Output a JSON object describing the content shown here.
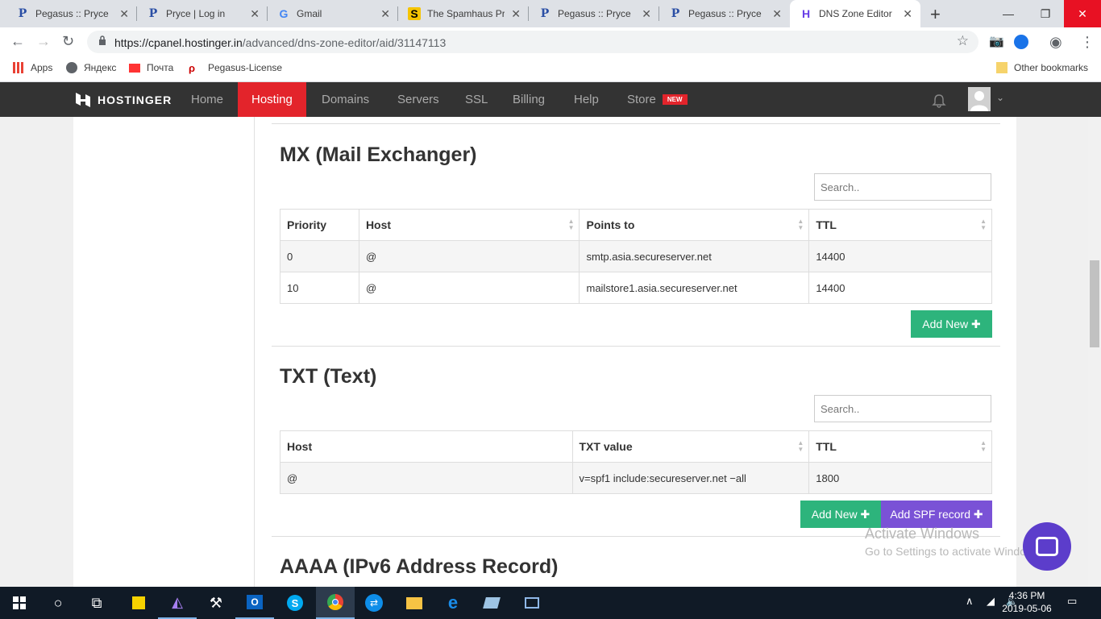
{
  "browser": {
    "tabs": [
      {
        "title": "Pegasus :: Pryce",
        "icon": "pegasus-p-icon"
      },
      {
        "title": "Pryce | Log in",
        "icon": "pegasus-p-icon"
      },
      {
        "title": "Gmail",
        "icon": "google-g-icon"
      },
      {
        "title": "The Spamhaus Pro",
        "icon": "spamhaus-s-icon"
      },
      {
        "title": "Pegasus :: Pryce",
        "icon": "pegasus-p-icon"
      },
      {
        "title": "Pegasus :: Pryce",
        "icon": "pegasus-p-icon"
      },
      {
        "title": "DNS Zone Editor",
        "icon": "hostinger-h-icon"
      }
    ],
    "url_host": "https://cpanel.hostinger.in",
    "url_path": "/advanced/dns-zone-editor/aid/31147113",
    "bookmarks": [
      "Apps",
      "Яндекс",
      "Почта",
      "Pegasus-License"
    ],
    "other_bookmarks": "Other bookmarks"
  },
  "site": {
    "logo": "HOSTINGER",
    "nav": [
      "Home",
      "Hosting",
      "Domains",
      "Servers",
      "SSL",
      "Billing",
      "Help",
      "Store"
    ],
    "active_nav": "Hosting",
    "store_badge": "NEW",
    "accent": "#e3242b"
  },
  "mx": {
    "title": "MX (Mail Exchanger)",
    "search_placeholder": "Search..",
    "columns": [
      "Priority",
      "Host",
      "Points to",
      "TTL"
    ],
    "rows": [
      [
        "0",
        "@",
        "smtp.asia.secureserver.net",
        "14400"
      ],
      [
        "10",
        "@",
        "mailstore1.asia.secureserver.net",
        "14400"
      ]
    ],
    "add_new": "Add New"
  },
  "txt": {
    "title": "TXT (Text)",
    "search_placeholder": "Search..",
    "columns": [
      "Host",
      "TXT value",
      "TTL"
    ],
    "rows": [
      [
        "@",
        "v=spf1 include:secureserver.net −all",
        "1800"
      ]
    ],
    "add_new": "Add New",
    "add_spf": "Add SPF record"
  },
  "aaaa": {
    "title": "AAAA (IPv6 Address Record)"
  },
  "watermark": {
    "line1": "Activate Windows",
    "line2": "Go to Settings to activate Windows."
  },
  "taskbar": {
    "time": "4:36 PM",
    "date": "2019-05-06"
  }
}
